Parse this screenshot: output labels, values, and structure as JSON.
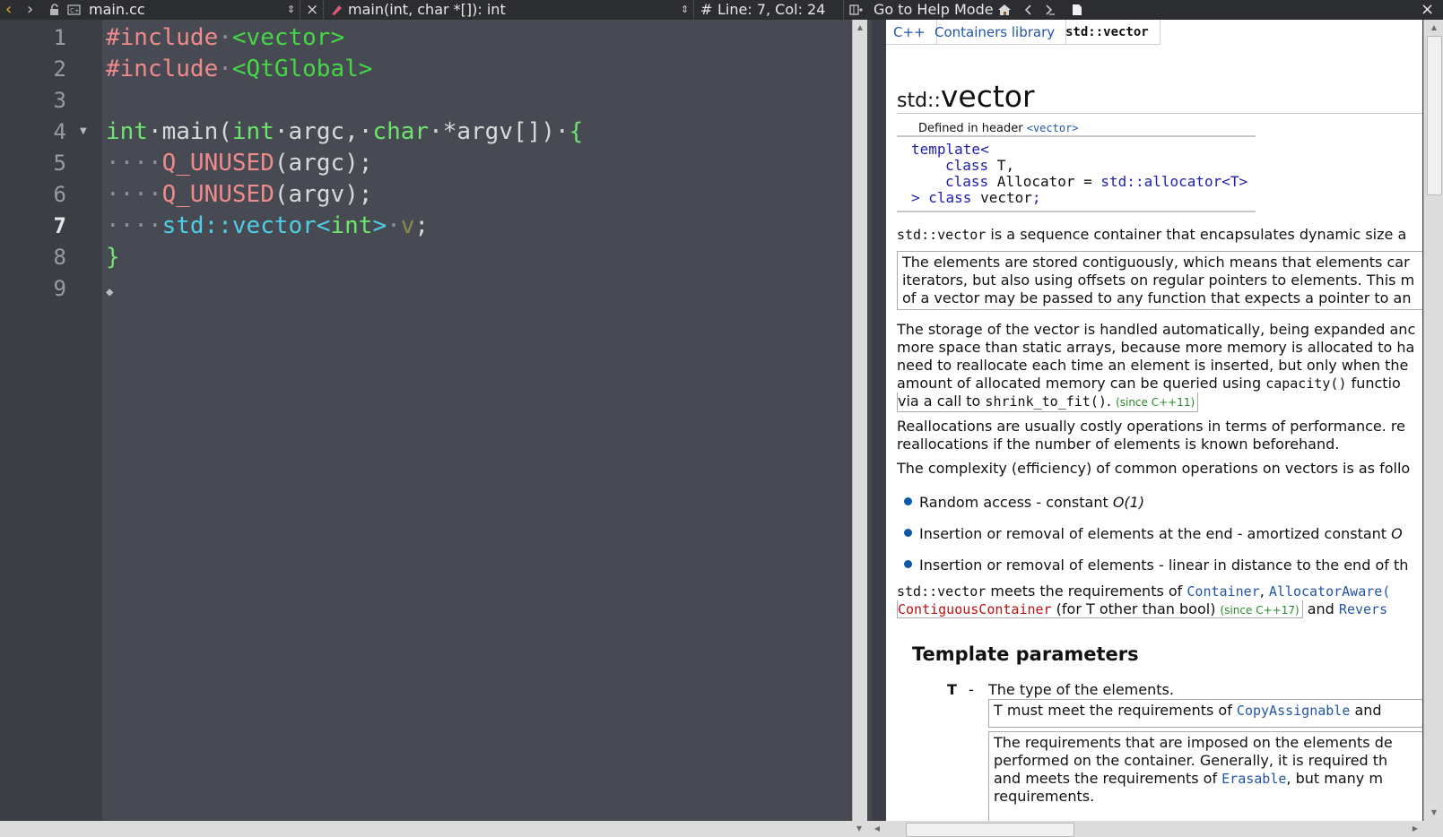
{
  "toolbar": {
    "back_icon": "‹",
    "forward_icon": "›",
    "file_name": "main.cc",
    "symbol_name": "main(int, char *[]): int",
    "hash": "#",
    "position": "Line: 7, Col: 24",
    "help_mode": "Go to Help Mode",
    "close_icon": "×"
  },
  "editor": {
    "line_numbers": [
      "1",
      "2",
      "3",
      "4",
      "5",
      "6",
      "7",
      "8",
      "9"
    ],
    "current_line": 7,
    "lines": {
      "l1_directive": "#include",
      "l1_ws": "·",
      "l1_header": "<vector>",
      "l2_directive": "#include",
      "l2_ws": "·",
      "l2_header": "<QtGlobal>",
      "l4_type": "int",
      "l4_a": "·main(",
      "l4_type2": "int",
      "l4_b": "·argc,·",
      "l4_type3": "char",
      "l4_c": "·*argv[])·",
      "l4_brace": "{",
      "l5_ws": "····",
      "l5_macro": "Q_UNUSED",
      "l5_rest": "(argc);",
      "l6_ws": "····",
      "l6_macro": "Q_UNUSED",
      "l6_rest": "(argv);",
      "l7_ws": "····",
      "l7_ns": "std::vector<",
      "l7_type": "int",
      "l7_ns2": ">",
      "l7_ws2": "·",
      "l7_var": "v",
      "l7_semi": ";",
      "l8_brace": "}",
      "l9_marker": "◆"
    }
  },
  "help": {
    "breadcrumbs": [
      "C++",
      "Containers library",
      "std::vector"
    ],
    "title_prefix": "std::",
    "title_main": "vector",
    "defined_in": "Defined in header ",
    "defined_header": "<vector>",
    "decl": {
      "line1": "template<",
      "line2_kw": "class",
      "line2_rest": " T,",
      "line3_kw": "class",
      "line3_rest": " Allocator = ",
      "line3_alloc": "std::allocator<T>",
      "line4_a": "> ",
      "line4_kw": "class",
      "line4_rest": " vector",
      "line4_semi": ";"
    },
    "intro_code": "std::vector",
    "intro_text": " is a sequence container that encapsulates dynamic size a",
    "box1": {
      "l1": "The elements are stored contiguously, which means that elements car",
      "l2": "iterators, but also using offsets on regular pointers to elements. This m",
      "l3": "of a vector may be passed to any function that expects a pointer to an"
    },
    "storage": {
      "l1": "The storage of the vector is handled automatically, being expanded anc",
      "l2": "more space than static arrays, because more memory is allocated to ha",
      "l3": "need to reallocate each time an element is inserted, but only when the",
      "l4a": "amount of allocated memory can be queried using ",
      "l4_code": "capacity()",
      "l4b": " functio",
      "l5a": "via a call to ",
      "l5_code": "shrink_to_fit()",
      "l5b": ". ",
      "l5_since": "(since C++11)"
    },
    "realloc": {
      "l1": "Reallocations are usually costly operations in terms of performance. re",
      "l2": "reallocations if the number of elements is known beforehand."
    },
    "complexity": "The complexity (efficiency) of common operations on vectors is as follo",
    "bullets": {
      "b1": "Random access - constant ",
      "b1_em": "O(1)",
      "b2": "Insertion or removal of elements at the end - amortized constant ",
      "b2_em": "O",
      "b3": "Insertion or removal of elements - linear in distance to the end of th"
    },
    "meets": {
      "code": "std::vector",
      "a": " meets the requirements of ",
      "link1": "Container",
      "comma": ", ",
      "link2": "AllocatorAware(",
      "link3": "ContiguousContainer",
      "b": " (for T other than bool) ",
      "since": "(since C++17)",
      "c": " and ",
      "link4": "Revers"
    },
    "section_title": "Template parameters",
    "param": {
      "name": "T",
      "dash": "-",
      "desc": "The type of the elements.",
      "box1a": "T must meet the requirements of ",
      "box1_link": "CopyAssignable",
      "box1b": " and",
      "box2_l1": "The requirements that are imposed on the elements de",
      "box2_l2": "performed on the container. Generally, it is required th",
      "box2_l3a": "and meets the requirements of ",
      "box2_l3_link": "Erasable",
      "box2_l3b": ", but many m",
      "box2_l4": "requirements."
    }
  },
  "colors": {
    "editor_bg": "#474a53",
    "gutter_bg": "#3c3e45",
    "toolbar_bg": "#2b2d31",
    "preprocessor": "#ef8b8b",
    "header": "#46d646",
    "type": "#6ee56e",
    "namespace": "#4ecde6",
    "link": "#2255aa"
  }
}
